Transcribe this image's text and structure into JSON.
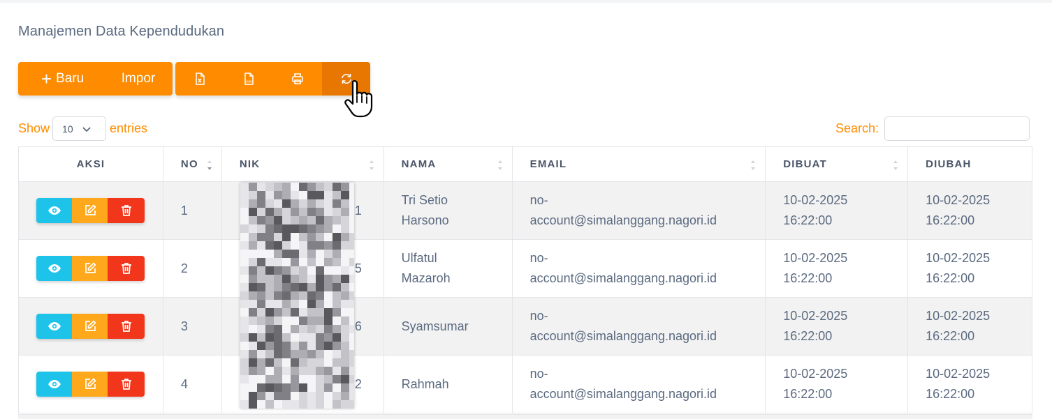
{
  "page": {
    "title": "Manajemen Data Kependudukan"
  },
  "toolbar": {
    "baru_label": "Baru",
    "impor_label": "Impor",
    "icons": [
      "excel-icon",
      "csv-icon",
      "print-icon",
      "refresh-icon"
    ]
  },
  "length": {
    "show": "Show",
    "value": "10",
    "entries": "entries"
  },
  "search": {
    "label": "Search:",
    "value": ""
  },
  "table": {
    "headers": [
      "AKSI",
      "NO",
      "NIK",
      "NAMA",
      "EMAIL",
      "DIBUAT",
      "DIUBAH"
    ],
    "rows": [
      {
        "no": "1",
        "nik_head": "1",
        "nik_tail": "1",
        "nama": "Tri Setio Harsono",
        "email": "no-account@simalanggang.nagori.id",
        "dibuat": "10-02-2025 16:22:00",
        "diubah": "10-02-2025 16:22:00"
      },
      {
        "no": "2",
        "nik_head": "1",
        "nik_tail": "5",
        "nama": "Ulfatul Mazaroh",
        "email": "no-account@simalanggang.nagori.id",
        "dibuat": "10-02-2025 16:22:00",
        "diubah": "10-02-2025 16:22:00"
      },
      {
        "no": "3",
        "nik_head": "1",
        "nik_tail": "6",
        "nama": "Syamsumar",
        "email": "no-account@simalanggang.nagori.id",
        "dibuat": "10-02-2025 16:22:00",
        "diubah": "10-02-2025 16:22:00"
      },
      {
        "no": "4",
        "nik_head": "1",
        "nik_tail": "2",
        "nama": "Rahmah",
        "email": "no-account@simalanggang.nagori.id",
        "dibuat": "10-02-2025 16:22:00",
        "diubah": "10-02-2025 16:22:00"
      }
    ]
  },
  "colors": {
    "accent": "#ff8c00",
    "accent_active": "#e77700",
    "view": "#1ec3ea",
    "edit": "#ffa81b",
    "delete": "#f2361c"
  }
}
